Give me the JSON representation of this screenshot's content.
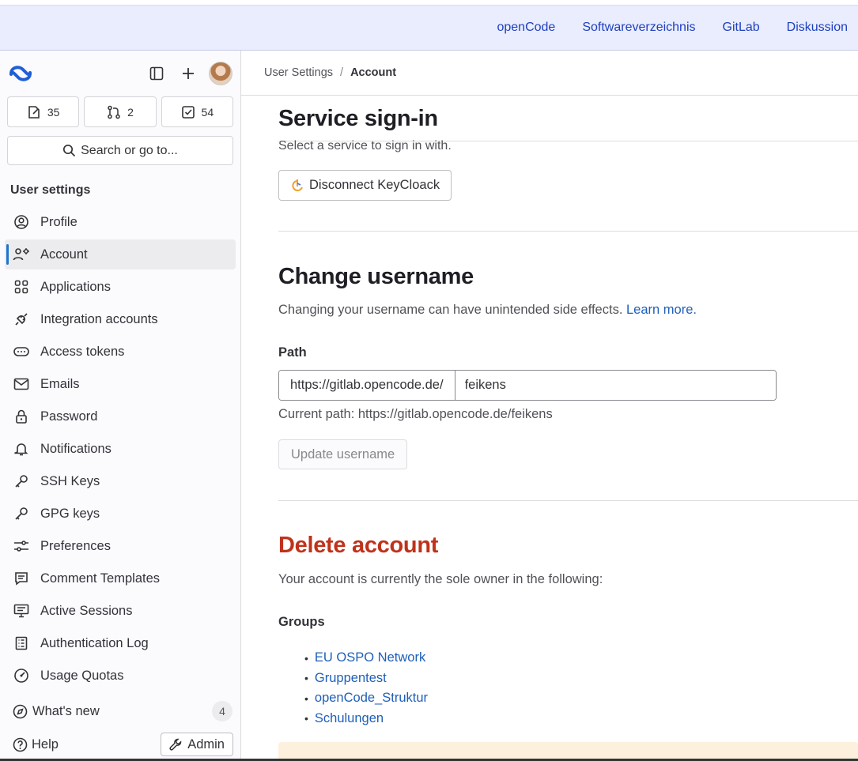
{
  "topnav": {
    "links": [
      "openCode",
      "Softwareverzeichnis",
      "GitLab",
      "Diskussion"
    ]
  },
  "sidebar": {
    "counts": {
      "issues": "35",
      "merge_requests": "2",
      "todos": "54"
    },
    "search_label": "Search or go to...",
    "section_title": "User settings",
    "items": [
      {
        "label": "Profile",
        "icon": "profile-icon"
      },
      {
        "label": "Account",
        "icon": "account-icon",
        "active": true
      },
      {
        "label": "Applications",
        "icon": "applications-icon"
      },
      {
        "label": "Integration accounts",
        "icon": "integration-icon"
      },
      {
        "label": "Access tokens",
        "icon": "token-icon"
      },
      {
        "label": "Emails",
        "icon": "mail-icon"
      },
      {
        "label": "Password",
        "icon": "lock-icon"
      },
      {
        "label": "Notifications",
        "icon": "bell-icon"
      },
      {
        "label": "SSH Keys",
        "icon": "key-icon"
      },
      {
        "label": "GPG keys",
        "icon": "key-icon"
      },
      {
        "label": "Preferences",
        "icon": "preferences-icon"
      },
      {
        "label": "Comment Templates",
        "icon": "comment-icon"
      },
      {
        "label": "Active Sessions",
        "icon": "monitor-icon"
      },
      {
        "label": "Authentication Log",
        "icon": "log-icon"
      },
      {
        "label": "Usage Quotas",
        "icon": "quota-icon"
      }
    ],
    "whats_new": "What's new",
    "whats_new_count": "4",
    "help": "Help",
    "admin": "Admin"
  },
  "breadcrumb": {
    "parent": "User Settings",
    "current": "Account"
  },
  "service_signin": {
    "title": "Service sign-in",
    "subtitle": "Select a service to sign in with.",
    "button": "Disconnect KeyCloack"
  },
  "change_username": {
    "title": "Change username",
    "description": "Changing your username can have unintended side effects.",
    "learn_more": "Learn more.",
    "path_label": "Path",
    "prefix": "https://gitlab.opencode.de/",
    "value": "feikens",
    "current_path": "Current path: https://gitlab.opencode.de/feikens",
    "button": "Update username"
  },
  "delete_account": {
    "title": "Delete account",
    "description": "Your account is currently the sole owner in the following:",
    "groups_label": "Groups",
    "groups": [
      "EU OSPO Network",
      "Gruppentest",
      "openCode_Struktur",
      "Schulungen"
    ]
  },
  "colors": {
    "accent": "#1f75cb",
    "danger": "#c0321b",
    "topbar_bg": "#e9edfd"
  }
}
